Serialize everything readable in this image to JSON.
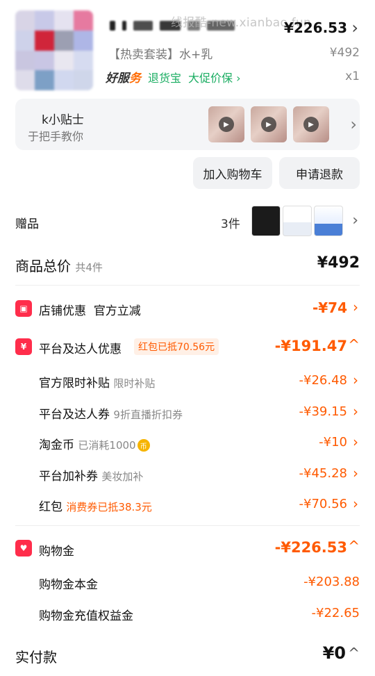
{
  "product": {
    "watermark": "线报酷-new.xianbao.fun",
    "price": "¥226.53",
    "variant": "【热卖套装】水+乳",
    "unit_price": "¥492",
    "quantity": "x1",
    "service_brand_a": "好服",
    "service_brand_b": "务",
    "return_insurance": "退货宝",
    "price_protect": "大促价保",
    "thumb_colors": [
      "#d8d4e6",
      "#c8c9e8",
      "#e5e2f0",
      "#e67aa0",
      "#ced2ea",
      "#d0253a",
      "#9c9fb2",
      "#aeb6e6",
      "#c9c6e0",
      "#c9c6e4",
      "#e9e7f0",
      "#d6dbf0",
      "#dedcea",
      "#7da0c6",
      "#d1d8ef",
      "#cfd6ea"
    ]
  },
  "tips": {
    "title": "k小贴士",
    "subtitle": "于把手教你"
  },
  "actions": {
    "add_to_cart": "加入购物车",
    "refund": "申请退款"
  },
  "gift": {
    "label": "赠品",
    "count": "3件"
  },
  "summary": {
    "total_label": "商品总价",
    "total_count": "共4件",
    "total_value": "¥492",
    "store_discount_label": "店铺优惠",
    "store_discount_sub": "官方立减",
    "store_discount_value": "-¥74",
    "platform_label": "平台及达人优惠",
    "platform_tag": "红包已抵70.56元",
    "platform_value": "-¥191.47",
    "sub_items": [
      {
        "label": "官方限时补贴",
        "sub": "限时补贴",
        "value": "-¥26.48"
      },
      {
        "label": "平台及达人券",
        "sub": "9折直播折扣券",
        "value": "-¥39.15"
      },
      {
        "label": "淘金币",
        "sub": "已消耗1000",
        "value": "-¥10"
      },
      {
        "label": "平台加补券",
        "sub": "美妆加补",
        "value": "-¥45.28"
      },
      {
        "label": "红包",
        "sub": "消费券已抵38.3元",
        "value": "-¥70.56"
      }
    ],
    "shopping_money_label": "购物金",
    "shopping_money_value": "-¥226.53",
    "shopping_principal_label": "购物金本金",
    "shopping_principal_value": "-¥203.88",
    "shopping_bonus_label": "购物金充值权益金",
    "shopping_bonus_value": "-¥22.65",
    "paid_label": "实付款",
    "paid_value": "¥0"
  }
}
